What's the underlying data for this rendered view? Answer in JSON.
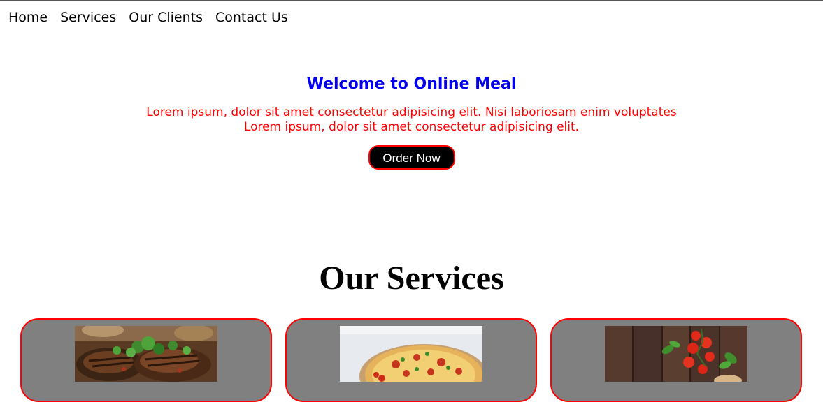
{
  "nav": {
    "items": [
      {
        "label": "Home"
      },
      {
        "label": "Services"
      },
      {
        "label": "Our Clients"
      },
      {
        "label": "Contact Us"
      }
    ]
  },
  "hero": {
    "title": "Welcome to Online Meal",
    "description_line1": "Lorem ipsum, dolor sit amet consectetur adipisicing elit. Nisi laboriosam enim voluptates",
    "description_line2": "Lorem ipsum, dolor sit amet consectetur adipisicing elit.",
    "button_label": "Order Now"
  },
  "services": {
    "title": "Our Services",
    "cards": [
      {
        "image": "grilled-steak-image"
      },
      {
        "image": "pizza-image"
      },
      {
        "image": "tomatoes-basil-image"
      }
    ]
  },
  "colors": {
    "title_blue": "#0000ee",
    "text_red": "#ff0000",
    "card_gray": "#808080",
    "button_black": "#000000"
  }
}
